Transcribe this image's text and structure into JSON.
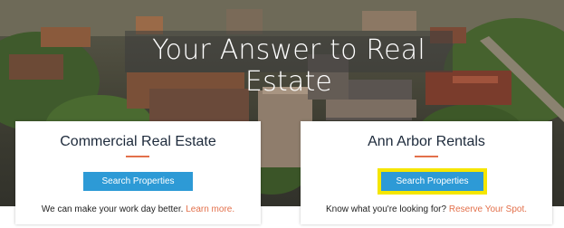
{
  "hero": {
    "title": "Your Answer to Real Estate"
  },
  "cards": [
    {
      "title": "Commercial Real Estate",
      "button_label": "Search Properties",
      "text": "We can make your work day better.",
      "link": "Learn more."
    },
    {
      "title": "Ann Arbor Rentals",
      "button_label": "Search Properties",
      "text": "Know what you're looking for?",
      "link": "Reserve Your Spot."
    }
  ],
  "colors": {
    "accent": "#e3704b",
    "button": "#2d9ad6",
    "highlight": "#f5e600",
    "heading": "#1d2a3b"
  }
}
